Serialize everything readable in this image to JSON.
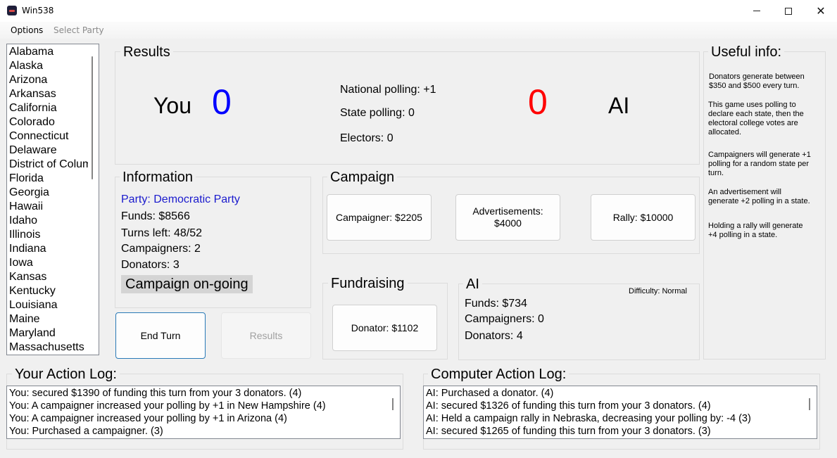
{
  "window": {
    "title": "Win538"
  },
  "menu": {
    "options": "Options",
    "select_party": "Select Party"
  },
  "states": [
    "Alabama",
    "Alaska",
    "Arizona",
    "Arkansas",
    "California",
    "Colorado",
    "Connecticut",
    "Delaware",
    "District of Colum",
    "Florida",
    "Georgia",
    "Hawaii",
    "Idaho",
    "Illinois",
    "Indiana",
    "Iowa",
    "Kansas",
    "Kentucky",
    "Louisiana",
    "Maine",
    "Maryland",
    "Massachusetts"
  ],
  "results": {
    "title": "Results",
    "you_label": "You",
    "you_score": "0",
    "ai_label": "AI",
    "ai_score": "0",
    "national_polling": "National polling: +1",
    "state_polling": "State polling: 0",
    "electors": "Electors: 0"
  },
  "information": {
    "title": "Information",
    "party": "Party: Democratic Party",
    "funds": "Funds: $8566",
    "turns_left": "Turns left: 48/52",
    "campaigners": "Campaigners: 2",
    "donators": "Donators: 3",
    "status": "Campaign on-going"
  },
  "campaign": {
    "title": "Campaign",
    "campaigner_btn": "Campaigner: $2205",
    "advertisements_btn": "Advertisements: $4000",
    "rally_btn": "Rally: $10000"
  },
  "fundraising": {
    "title": "Fundraising",
    "donator_btn": "Donator: $1102"
  },
  "ai": {
    "title": "AI",
    "difficulty": "Difficulty: Normal",
    "funds": "Funds: $734",
    "campaigners": "Campaigners: 0",
    "donators": "Donators: 4"
  },
  "buttons": {
    "end_turn": "End Turn",
    "results": "Results"
  },
  "useful_info": {
    "title": "Useful info:",
    "p1": "Donators generate between $350 and $500 every turn.",
    "p2": "This game uses polling to declare each state, then the electoral college votes are allocated.",
    "p3": "Campaigners will generate +1 polling for a random state per turn.",
    "p4": "An advertisement will generate +2 polling in a state.",
    "p5": "Holding a rally will generate +4 polling in a state."
  },
  "your_log": {
    "title": "Your Action Log:",
    "entries": [
      "You: secured $1390 of funding this turn from your 3 donators. (4)",
      "You: A campaigner increased your polling by +1 in New Hampshire (4)",
      "You: A campaigner increased your polling by +1 in Arizona (4)",
      "You: Purchased a campaigner. (3)"
    ]
  },
  "computer_log": {
    "title": "Computer Action Log:",
    "entries": [
      "AI: Purchased a donator. (4)",
      "AI: secured $1326 of funding this turn from your 3 donators. (4)",
      "AI: Held a campaign rally in Nebraska, decreasing your polling by: -4 (3)",
      "AI: secured $1265 of funding this turn from your 3 donators. (3)"
    ]
  },
  "colors": {
    "you": "#0000ff",
    "ai": "#ff0000",
    "party": "#1a1acd",
    "accent": "#2a7ab7"
  }
}
